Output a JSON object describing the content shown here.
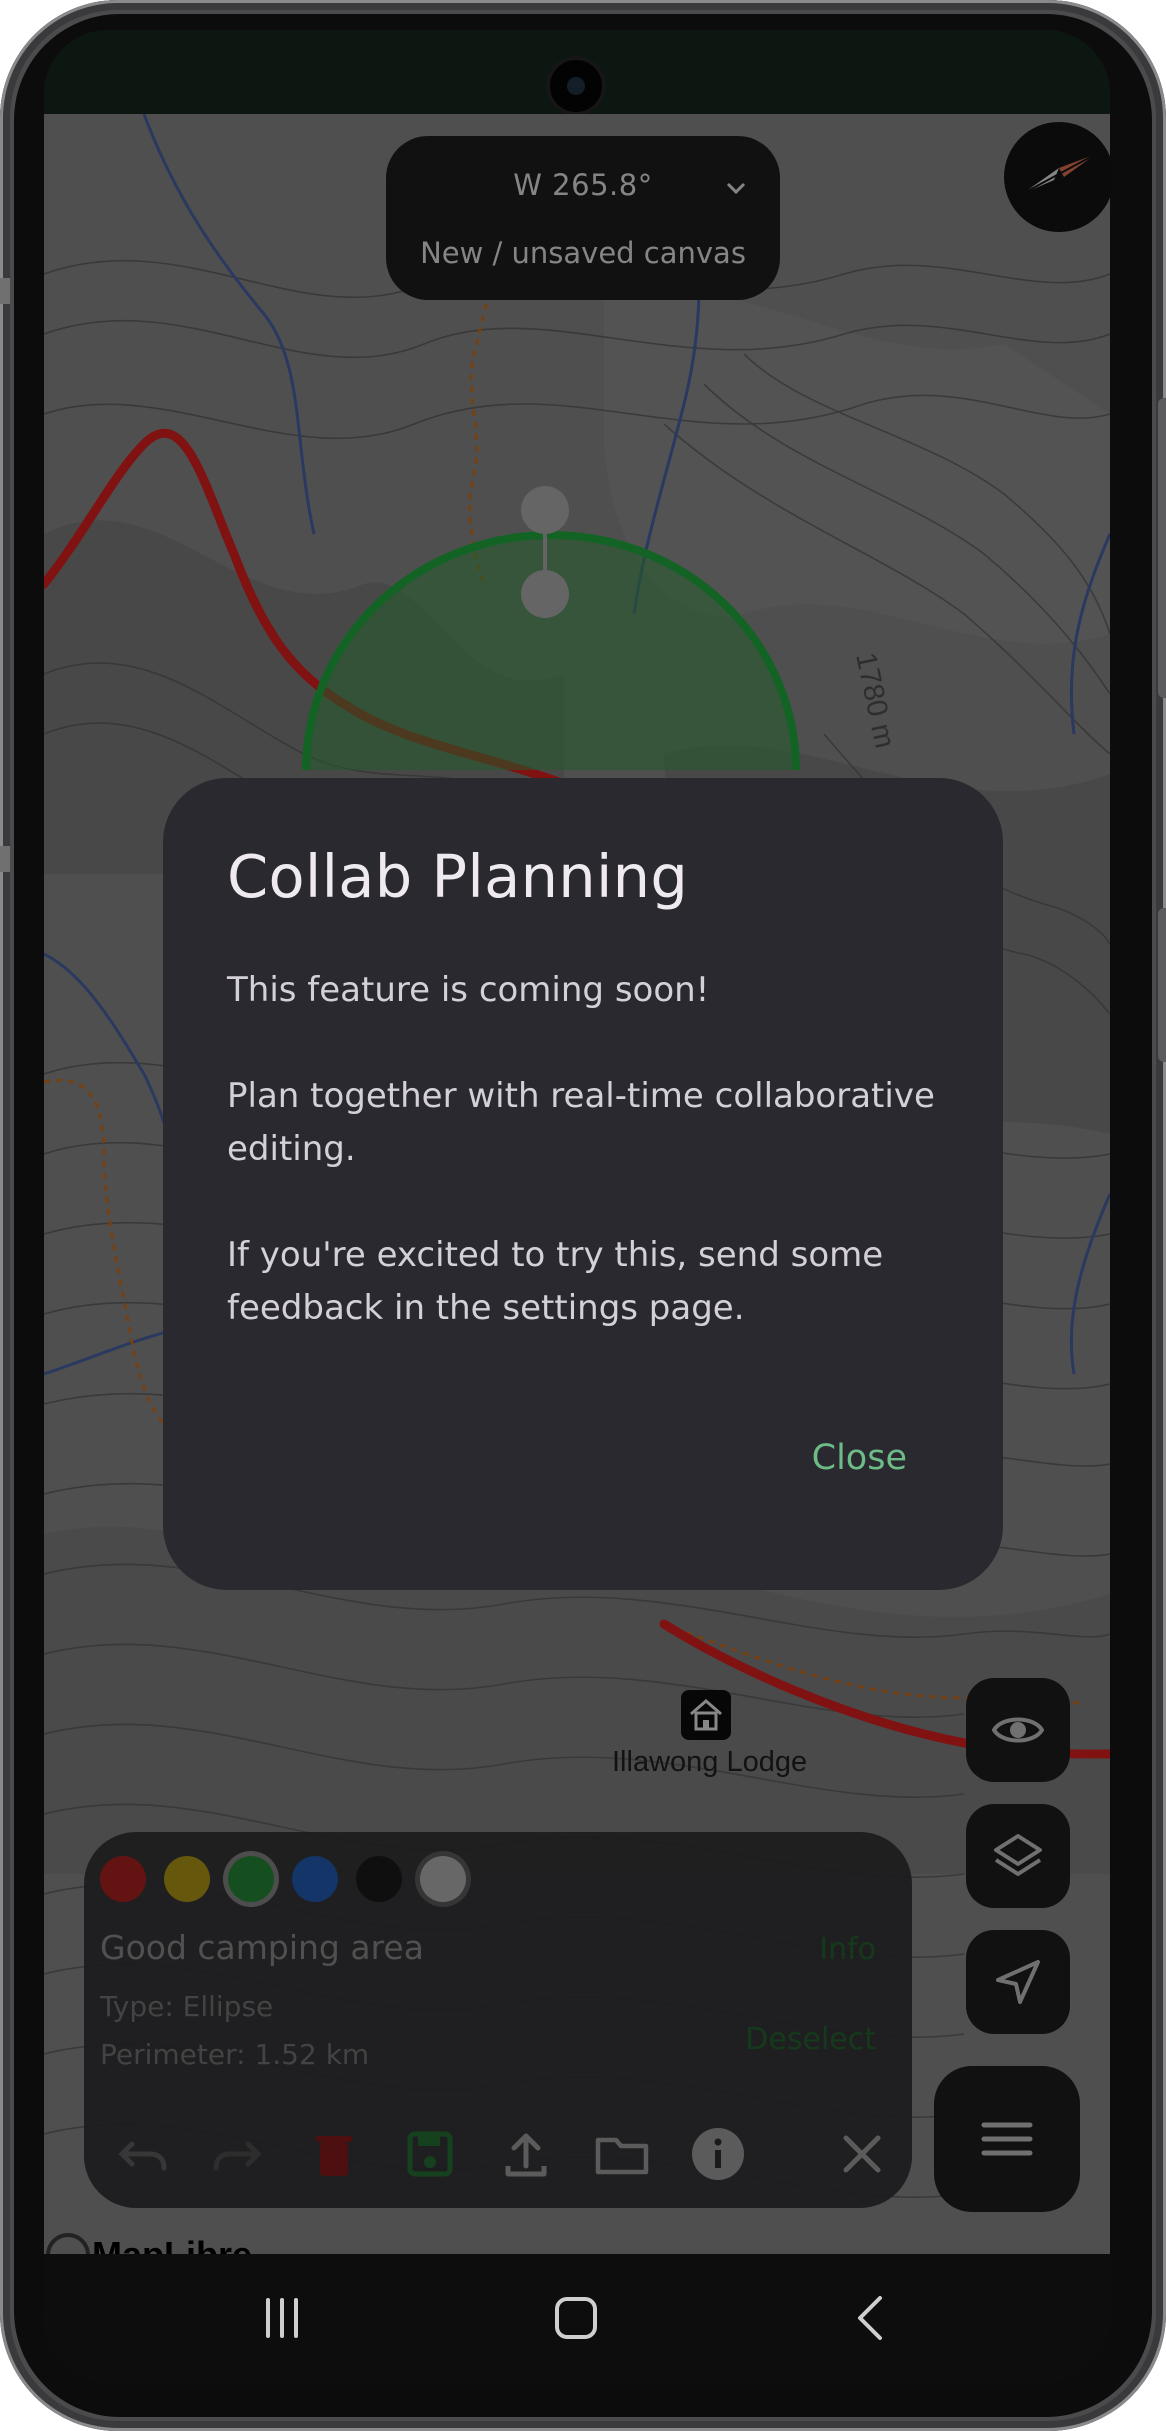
{
  "top_pill": {
    "heading": "W 265.8°",
    "canvas_status": "New / unsaved canvas"
  },
  "map": {
    "contour_label": "1780 m",
    "place_label": "Illawong Lodge",
    "attribution": "MapLibre",
    "colors": {
      "terrain": "#6f6f6f",
      "contour": "#4a4a4a",
      "water": "#3b4f86",
      "road": "#b21a1a",
      "track": "#a15a1d",
      "shape_fill": "#2f7e3a",
      "shape_stroke": "#1b8a34"
    }
  },
  "drawing": {
    "swatches": [
      {
        "color": "#8b1b1b",
        "name": "red"
      },
      {
        "color": "#8c7a12",
        "name": "yellow"
      },
      {
        "color": "#1f6e2c",
        "name": "green"
      },
      {
        "color": "#1b4a8f",
        "name": "blue"
      },
      {
        "color": "#151515",
        "name": "black"
      },
      {
        "color": "#8f8f8f",
        "name": "gray"
      }
    ],
    "feature_name": "Good camping area",
    "feature_type": "Type: Ellipse",
    "feature_perimeter": "Perimeter: 1.52 km",
    "info_label": "Info",
    "deselect_label": "Deselect"
  },
  "dialog": {
    "title": "Collab Planning",
    "paragraphs": [
      "This feature is coming soon!",
      "Plan together with real-time collaborative editing.",
      "If you're excited to try this, send some feedback in the settings page."
    ],
    "close_label": "Close"
  }
}
